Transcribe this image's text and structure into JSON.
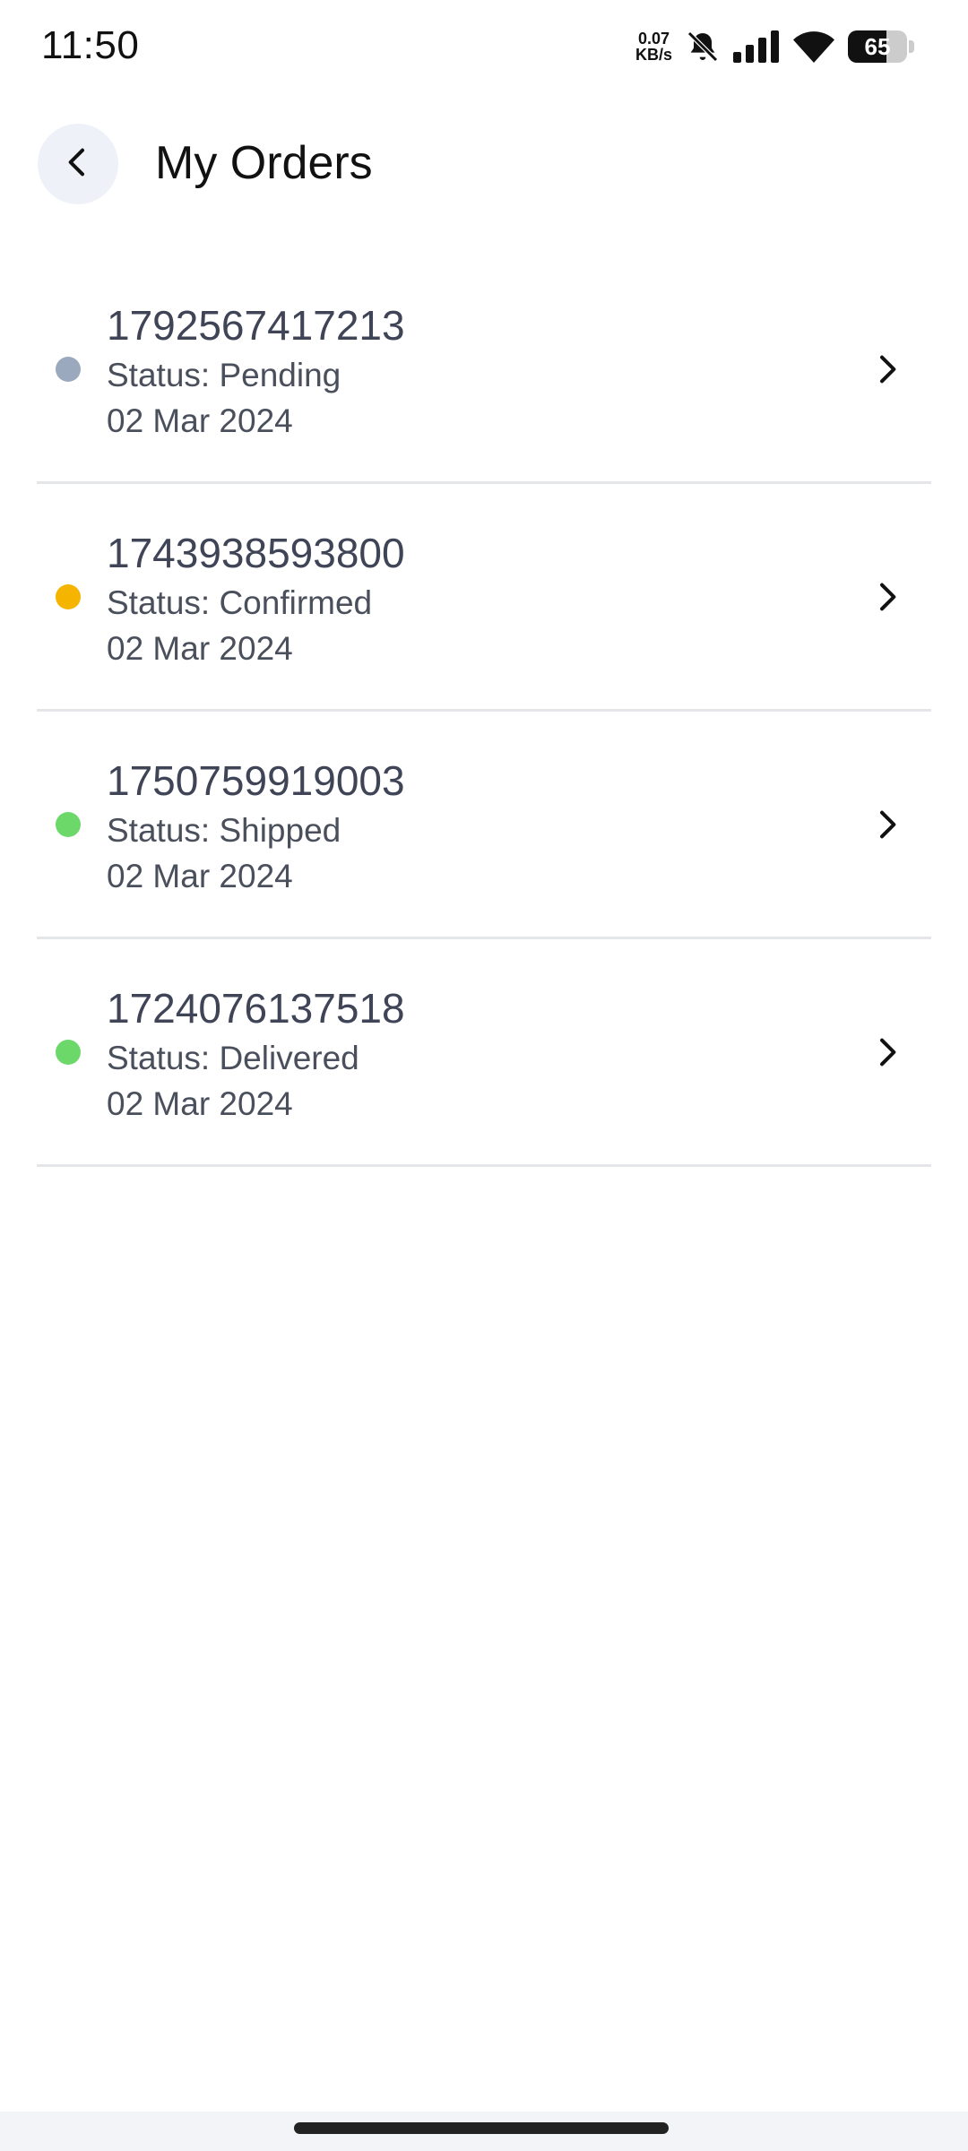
{
  "status_bar": {
    "time": "11:50",
    "net_speed_value": "0.07",
    "net_speed_unit": "KB/s",
    "battery_level": "65",
    "battery_fraction": 0.65,
    "icons": [
      "bell-muted-icon",
      "signal-icon",
      "wifi-icon",
      "battery-icon"
    ]
  },
  "header": {
    "title": "My Orders",
    "back_icon": "chevron-left-icon"
  },
  "orders": [
    {
      "id": "1792567417213",
      "status": "Status: Pending",
      "date": "02 Mar 2024",
      "dot_color": "#9aa9bd"
    },
    {
      "id": "1743938593800",
      "status": "Status: Confirmed",
      "date": "02 Mar 2024",
      "dot_color": "#f4b400"
    },
    {
      "id": "1750759919003",
      "status": "Status: Shipped",
      "date": "02 Mar 2024",
      "dot_color": "#6dd86a"
    },
    {
      "id": "1724076137518",
      "status": "Status: Delivered",
      "date": "02 Mar 2024",
      "dot_color": "#6dd86a"
    }
  ],
  "colors": {
    "back_button_bg": "#eef2f8",
    "divider": "#e4e6ea",
    "order_id_text": "#3f4456",
    "secondary_text": "#4a4f5c"
  }
}
